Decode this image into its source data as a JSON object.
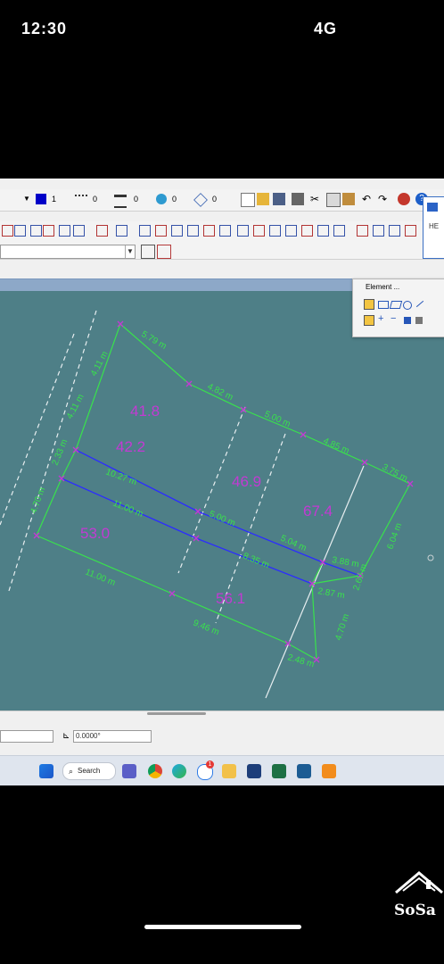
{
  "status": {
    "time": "12:30",
    "indicators": "4G"
  },
  "toolbar": {
    "row1": {
      "level": "1",
      "weight1": "0",
      "weight2": "0",
      "style": "0",
      "tint": "0"
    },
    "combo_value": ""
  },
  "element_panel": {
    "title": "Element ..."
  },
  "right_panel": {
    "label": "HE"
  },
  "bottom": {
    "angle": "0.0000°"
  },
  "taskbar": {
    "search_label": "Search",
    "badge_count": "1"
  },
  "drawing": {
    "edge_labels": [
      "5.79 m",
      "4.82 m",
      "5.00 m",
      "4.85 m",
      "3.75 m",
      "4.11 m",
      "4.11 m",
      "2.33 m",
      "4.70 m",
      "10.27 m",
      "11.00 m",
      "5.00 m",
      "5.04 m",
      "3.88 m",
      "6.04 m",
      "8.35 m",
      "11.00 m",
      "2.87 m",
      "2.60 m",
      "9.46 m",
      "2.48 m",
      "4.70 m"
    ],
    "area_labels": [
      "41.8",
      "42.2",
      "46.9",
      "67.4",
      "53.0",
      "56.1"
    ]
  },
  "watermark": {
    "text": "SoSa"
  },
  "colors": {
    "canvas": "#4e7f87",
    "edge_label": "#39e24c",
    "area_label": "#c23ad3",
    "blue_line": "#2c2cff",
    "white_dash": "#e7eef0"
  }
}
